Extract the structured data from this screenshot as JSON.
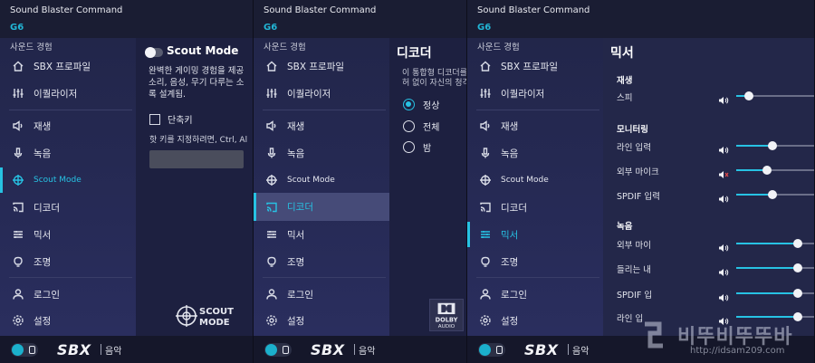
{
  "app": {
    "title": "Sound Blaster Command",
    "device": "G6"
  },
  "sidebar": {
    "section_label": "사운드 경험",
    "items": [
      {
        "id": "sbx",
        "label": "SBX 프로파일",
        "icon": "home-icon"
      },
      {
        "id": "equalizer",
        "label": "이퀄라이저",
        "icon": "equalizer-icon"
      },
      {
        "id": "playback",
        "label": "재생",
        "icon": "speaker-icon"
      },
      {
        "id": "recording",
        "label": "녹음",
        "icon": "microphone-icon"
      },
      {
        "id": "scout",
        "label": "Scout Mode",
        "icon": "crosshair-icon"
      },
      {
        "id": "decoder",
        "label": "디코더",
        "icon": "cast-icon"
      },
      {
        "id": "mixer",
        "label": "믹서",
        "icon": "sliders-icon"
      },
      {
        "id": "lighting",
        "label": "조명",
        "icon": "bulb-icon"
      },
      {
        "id": "login",
        "label": "로그인",
        "icon": "user-icon"
      },
      {
        "id": "settings",
        "label": "설정",
        "icon": "gear-icon"
      }
    ]
  },
  "bottom": {
    "sbx": "SBX",
    "mode": "음악"
  },
  "scout": {
    "title": "Scout Mode",
    "enabled": false,
    "desc": [
      "완벽한 게이밍 경험을 제공",
      "소리, 음성, 무기 다루는 소",
      "록 설계됨."
    ],
    "hotkey_label": "단축키",
    "hotkey_hint": "핫 키를 지정하려면, Ctrl, Al",
    "logo_line1": "SCOUT",
    "logo_line2": "MODE"
  },
  "decoder": {
    "title": "디코더",
    "desc": [
      "이 통합형 디코더를",
      "허 없이 자신의 청각"
    ],
    "options": [
      "정상",
      "전체",
      "밤"
    ],
    "selected": "정상",
    "logo_line1": "DOLBY",
    "logo_line2": "AUDIO"
  },
  "mixer": {
    "title": "믹서",
    "groups": [
      {
        "name": "재생",
        "rows": [
          {
            "label": "스피",
            "level": 0.16,
            "muted": false
          }
        ]
      },
      {
        "name": "모니터링",
        "rows": [
          {
            "label": "라인 입력",
            "level": 0.46,
            "muted": false
          },
          {
            "label": "외부 마이크",
            "level": 0.39,
            "muted": true
          },
          {
            "label": "SPDIF 입력",
            "level": 0.46,
            "muted": false
          }
        ]
      },
      {
        "name": "녹음",
        "rows": [
          {
            "label": "외부 마이",
            "level": 0.79,
            "muted": false
          },
          {
            "label": "들리는 내",
            "level": 0.79,
            "muted": false
          },
          {
            "label": "SPDIF 입",
            "level": 0.79,
            "muted": false
          },
          {
            "label": "라인 입",
            "level": 0.79,
            "muted": false
          }
        ]
      }
    ]
  },
  "watermark": {
    "text": "비뚜비뚜뚜바",
    "url": "http://idsam209.com"
  },
  "colors": {
    "accent": "#27c2e3",
    "sidebar": "#262a55",
    "content": "#1d2040",
    "topbar": "#1a1d33"
  }
}
